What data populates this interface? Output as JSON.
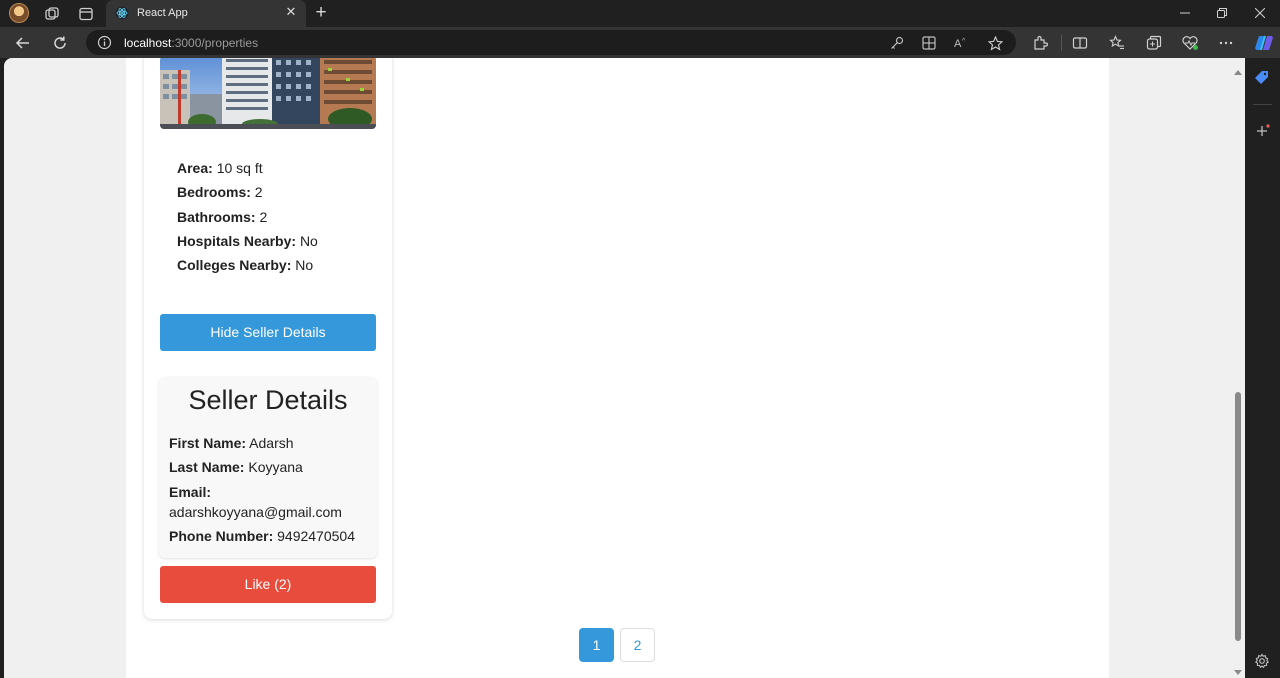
{
  "browser": {
    "tab_title": "React App",
    "url_host": "localhost",
    "url_rest": ":3000/properties",
    "icons": [
      "profile-avatar",
      "workspaces-icon",
      "tab-actions-icon",
      "react-favicon",
      "close-icon",
      "plus-icon",
      "minimize-icon",
      "restore-icon",
      "close-window-icon",
      "back-icon",
      "refresh-icon",
      "info-icon",
      "key-icon",
      "apps-icon",
      "read-aloud-icon",
      "star-icon",
      "extensions-icon",
      "split-screen-icon",
      "favorites-icon",
      "collections-icon",
      "browser-essentials-icon",
      "more-icon",
      "copilot-icon",
      "settings-icon"
    ]
  },
  "property": {
    "details": [
      {
        "label": "Area:",
        "value": "10 sq ft"
      },
      {
        "label": "Bedrooms:",
        "value": "2"
      },
      {
        "label": "Bathrooms:",
        "value": "2"
      },
      {
        "label": "Hospitals Nearby:",
        "value": "No"
      },
      {
        "label": "Colleges Nearby:",
        "value": "No"
      }
    ],
    "hide_button": "Hide Seller Details",
    "like_button": "Like (2)"
  },
  "seller": {
    "title": "Seller Details",
    "first_name_label": "First Name:",
    "first_name": "Adarsh",
    "last_name_label": "Last Name:",
    "last_name": "Koyyana",
    "email_label": "Email:",
    "email": "adarshkoyyana@gmail.com",
    "phone_label": "Phone Number:",
    "phone": "9492470504"
  },
  "pagination": {
    "pages": [
      "1",
      "2"
    ],
    "current": "1"
  },
  "colors": {
    "primary": "#3498db",
    "danger": "#e74c3c"
  }
}
